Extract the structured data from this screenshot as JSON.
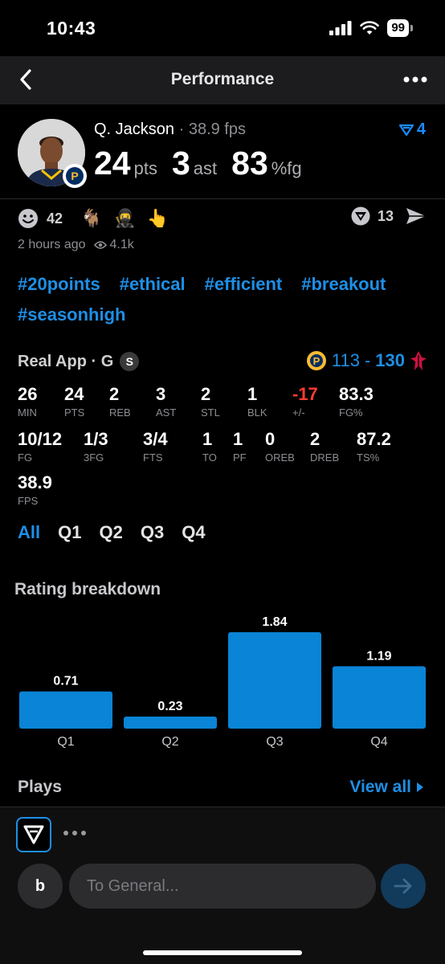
{
  "status": {
    "time": "10:43",
    "battery": "99"
  },
  "nav": {
    "title": "Performance"
  },
  "player": {
    "name": "Q. Jackson",
    "separator": " · ",
    "fps": "38.9 fps",
    "points": "24",
    "points_unit": "pts",
    "assists": "3",
    "assists_unit": "ast",
    "fg": "83",
    "fg_unit": "%fg",
    "filter_count": "4"
  },
  "reactions": {
    "smile_count": "42",
    "emojis": [
      "🐐",
      "🥷",
      "👆"
    ],
    "reshare_count": "13"
  },
  "meta": {
    "time_ago": "2 hours ago",
    "views": "4.1k"
  },
  "tags": [
    "#20points",
    "#ethical",
    "#efficient",
    "#breakout",
    "#seasonhigh"
  ],
  "game": {
    "source": "Real App · G",
    "badge": "S",
    "score_home": "113",
    "score_sep": "-",
    "score_away": "130"
  },
  "stats_row1": [
    {
      "value": "26",
      "label": "MIN"
    },
    {
      "value": "24",
      "label": "PTS"
    },
    {
      "value": "2",
      "label": "REB"
    },
    {
      "value": "3",
      "label": "AST"
    },
    {
      "value": "2",
      "label": "STL"
    },
    {
      "value": "1",
      "label": "BLK"
    },
    {
      "value": "-17",
      "label": "+/-"
    },
    {
      "value": "83.3",
      "label": "FG%"
    }
  ],
  "stats_row2": [
    {
      "value": "10/12",
      "label": "FG"
    },
    {
      "value": "1/3",
      "label": "3FG"
    },
    {
      "value": "3/4",
      "label": "FTS"
    },
    {
      "value": "1",
      "label": "TO"
    },
    {
      "value": "1",
      "label": "PF"
    },
    {
      "value": "0",
      "label": "OREB"
    },
    {
      "value": "2",
      "label": "DREB"
    },
    {
      "value": "87.2",
      "label": "TS%"
    }
  ],
  "stats_row3": [
    {
      "value": "38.9",
      "label": "FPS"
    }
  ],
  "quarter_tabs": [
    "All",
    "Q1",
    "Q2",
    "Q3",
    "Q4"
  ],
  "rating": {
    "title": "Rating breakdown"
  },
  "chart_data": {
    "type": "bar",
    "categories": [
      "Q1",
      "Q2",
      "Q3",
      "Q4"
    ],
    "values": [
      0.71,
      0.23,
      1.84,
      1.19
    ],
    "value_labels": [
      "0.71",
      "0.23",
      "1.84",
      "1.19"
    ],
    "title": "Rating breakdown",
    "ylim": [
      0,
      1.84
    ],
    "bar_color": "#0a84d6",
    "grid": false
  },
  "plays": {
    "title": "Plays",
    "view_all": "View all"
  },
  "composer": {
    "user_initial": "b",
    "placeholder": "To General..."
  },
  "colors": {
    "accent": "#1e8fe6",
    "negative": "#ff3b30",
    "bar": "#0a84d6"
  }
}
